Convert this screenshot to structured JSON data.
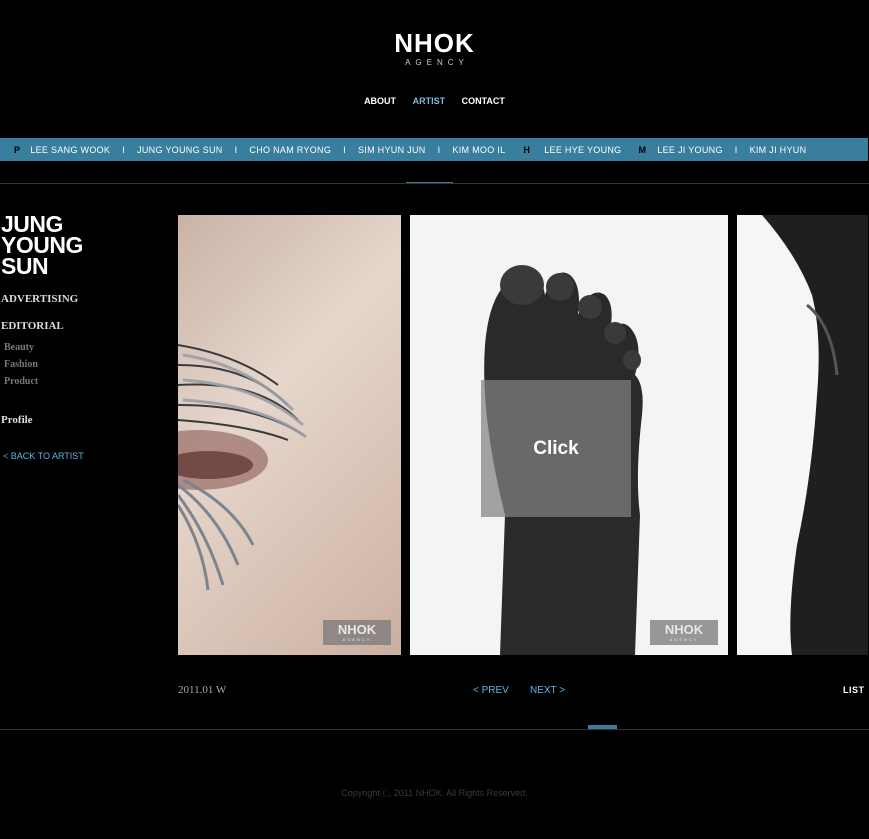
{
  "header": {
    "logo_main": "NHOK",
    "logo_sub": "AGENCY",
    "nav": [
      {
        "label": "ABOUT",
        "color": "#ffffff"
      },
      {
        "label": "ARTIST",
        "color": "#7fb8e0"
      },
      {
        "label": "CONTACT",
        "color": "#ffffff"
      }
    ]
  },
  "artist_bar": {
    "color": "#3a7e9e",
    "groups": [
      {
        "letter": "P",
        "names": [
          "LEE SANG WOOK",
          "JUNG YOUNG SUN",
          "CHO NAM RYONG",
          "SIM HYUN JUN",
          "KIM MOO IL"
        ]
      },
      {
        "letter": "H",
        "names": [
          "LEE HYE YOUNG"
        ]
      },
      {
        "letter": "M",
        "names": [
          "LEE JI YOUNG",
          "KIM JI HYUN"
        ]
      }
    ]
  },
  "sidebar": {
    "title": [
      "JUNG",
      "YOUNG",
      "SUN"
    ],
    "advertising": "ADVERTISING",
    "editorial": "EDITORIAL",
    "editorial_items": [
      "Beauty",
      "Fashion",
      "Product"
    ],
    "profile": "Profile",
    "back": "<  BACK TO ARTIST"
  },
  "gallery": {
    "watermark_main": "NHOK",
    "watermark_sub": "AGENCY",
    "click_label": "Click"
  },
  "footer_nav": {
    "date": "2011.01 W",
    "prev": "<  PREV",
    "next": "NEXT  >",
    "list": "LIST"
  },
  "copyright": "Copyrightⓒ, 2011 NHOK. All Rights Reserved."
}
